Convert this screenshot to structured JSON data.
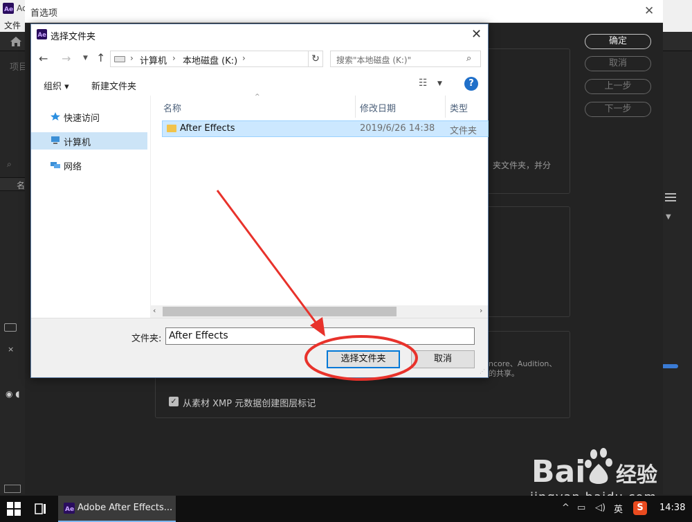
{
  "background_app": {
    "window_title": "Ac",
    "menu_file": "文件",
    "panel_label": "项目",
    "column_label": "名"
  },
  "preferences": {
    "title": "首选项",
    "buttons": {
      "ok": "确定",
      "cancel": "取消",
      "prev": "上一步",
      "next": "下一步"
    },
    "text_partial_1": "夹文件夹，并分",
    "text_partial_2": "ncore、Audition、",
    "text_partial_3": "的共享。",
    "checkbox_label": "从素材 XMP 元数据创建图层标记",
    "checkbox_checked": true
  },
  "dialog": {
    "title": "选择文件夹",
    "address": {
      "crumbs": [
        "计算机",
        "本地磁盘 (K:)"
      ]
    },
    "search_placeholder": "搜索\"本地磁盘 (K:)\"",
    "toolbar": {
      "organize": "组织 ▾",
      "new_folder": "新建文件夹"
    },
    "nav": [
      {
        "label": "快速访问",
        "icon": "star-icon",
        "selected": false
      },
      {
        "label": "计算机",
        "icon": "computer-icon",
        "selected": true
      },
      {
        "label": "网络",
        "icon": "network-icon",
        "selected": false
      }
    ],
    "columns": {
      "name": "名称",
      "date": "修改日期",
      "type": "类型"
    },
    "files": [
      {
        "name": "After Effects",
        "date": "2019/6/26 14:38",
        "type": "文件夹"
      }
    ],
    "folder_label": "文件夹:",
    "folder_value": "After Effects",
    "select_button": "选择文件夹",
    "cancel_button": "取消"
  },
  "watermark": {
    "brand": "Bai 经验",
    "url": "jingyan.baidu.com"
  },
  "taskbar": {
    "app_label": "Adobe After Effects...",
    "ime": "英",
    "sogou": "S",
    "time": "14:38"
  },
  "colors": {
    "accent": "#0078d7",
    "selection": "#cce8ff",
    "annotation_red": "#e8322b",
    "ae_purple": "#2a0d5e"
  }
}
